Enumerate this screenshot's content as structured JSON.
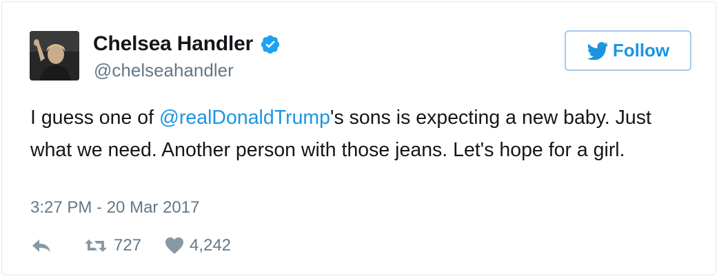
{
  "tweet": {
    "author_name": "Chelsea Handler",
    "author_handle": "@chelseahandler",
    "text_before": "I guess one of ",
    "mention": "@realDonaldTrump",
    "text_after": "'s sons is expecting a new baby. Just what we need. Another person with those jeans. Let's hope for a girl.",
    "timestamp": "3:27 PM - 20 Mar 2017",
    "retweet_count": "727",
    "like_count": "4,242"
  },
  "follow_button": {
    "label": "Follow"
  },
  "icons": {
    "verified": "verified-badge-icon",
    "follow": "twitter-bird-icon",
    "reply": "reply-icon",
    "retweet": "retweet-icon",
    "like": "heart-icon"
  },
  "colors": {
    "accent": "#1b95e0",
    "muted": "#657786",
    "follow_border": "#a5c9ea"
  }
}
